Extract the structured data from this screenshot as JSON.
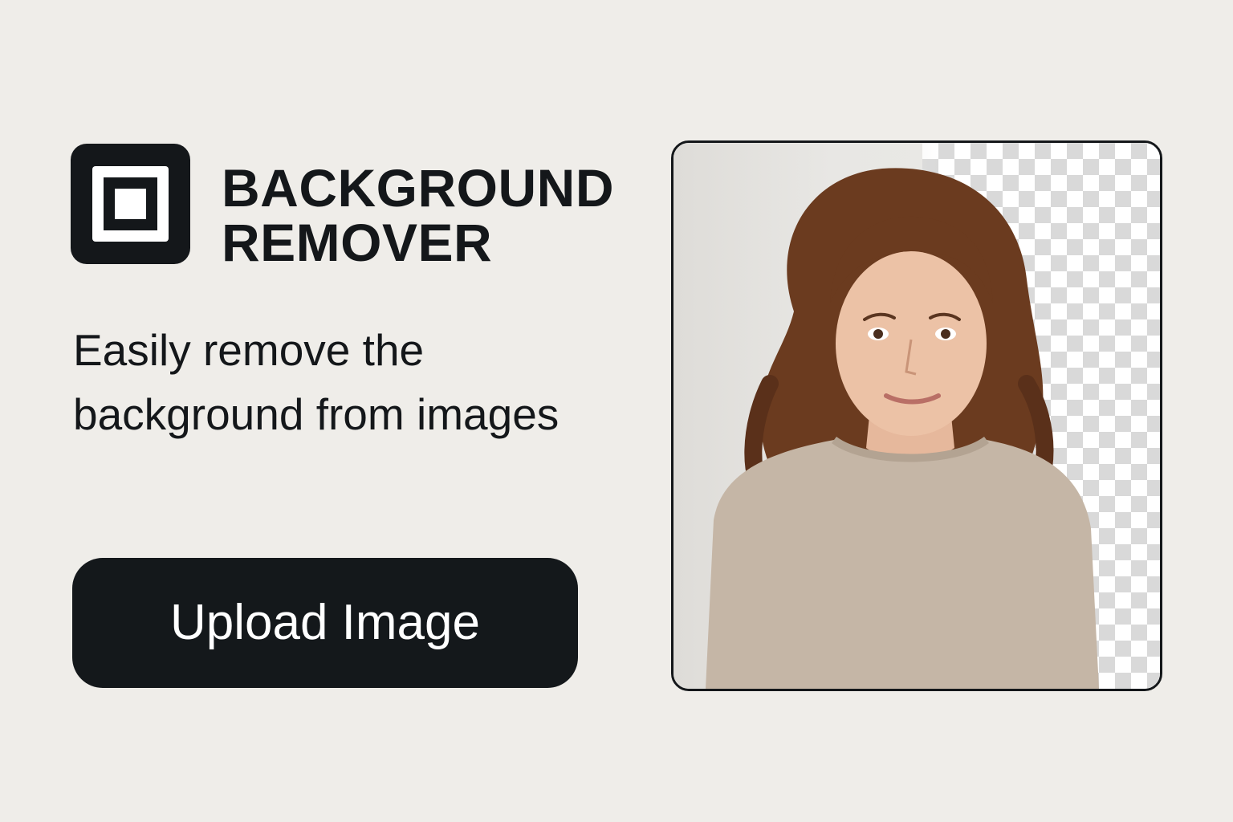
{
  "brand": {
    "line1": "BACKGROUND",
    "line2": "REMOVER",
    "logo_icon": "nested-square-icon"
  },
  "tagline": "Easily remove the background from images",
  "upload_button": {
    "label": "Upload Image"
  },
  "preview": {
    "subject": "portrait-photo",
    "transparent_area": "checkerboard-pattern"
  },
  "colors": {
    "page_background": "#efede9",
    "ink": "#14171a",
    "button_text": "#ffffff"
  }
}
